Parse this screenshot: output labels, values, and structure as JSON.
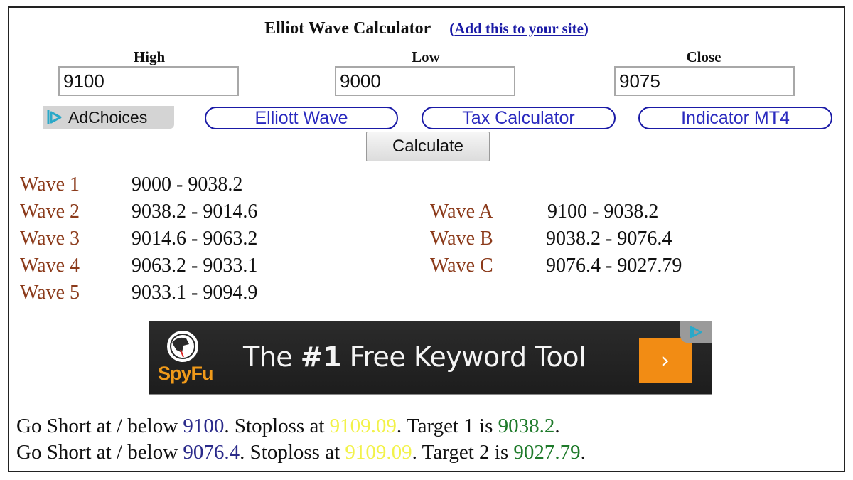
{
  "header": {
    "title": "Elliot Wave Calculator",
    "link_open": "(",
    "link_label": "Add this to your site",
    "link_close": ")"
  },
  "inputs": {
    "high": {
      "label": "High",
      "value": "9100"
    },
    "low": {
      "label": "Low",
      "value": "9000"
    },
    "close": {
      "label": "Close",
      "value": "9075"
    }
  },
  "adchoices": {
    "label": "AdChoices",
    "icon": "adchoices-icon"
  },
  "links": [
    {
      "label": "Elliott Wave"
    },
    {
      "label": "Tax Calculator"
    },
    {
      "label": "Indicator MT4"
    }
  ],
  "calculate_label": "Calculate",
  "impulse_waves": [
    {
      "name": "Wave 1",
      "range": "9000 - 9038.2"
    },
    {
      "name": "Wave 2",
      "range": "9038.2 - 9014.6"
    },
    {
      "name": "Wave 3",
      "range": "9014.6 - 9063.2"
    },
    {
      "name": "Wave 4",
      "range": "9063.2 - 9033.1"
    },
    {
      "name": "Wave 5",
      "range": "9033.1 - 9094.9"
    }
  ],
  "corrective_waves": [
    {
      "name": "Wave A",
      "range": "9100 - 9038.2"
    },
    {
      "name": "Wave B",
      "range": "9038.2 - 9076.4"
    },
    {
      "name": "Wave C",
      "range": "9076.4 - 9027.79"
    }
  ],
  "ad_banner": {
    "brand": "SpyFu",
    "headline_pre": "The ",
    "headline_bold": "#1",
    "headline_post": " Free Keyword Tool",
    "cta": "›"
  },
  "signals": [
    {
      "prefix": "Go Short at / below ",
      "entry": "9100",
      "mid": ". Stoploss at ",
      "stoploss": "9109.09",
      "target_label": ". Target 1 is ",
      "target": "9038.2",
      "suffix": "."
    },
    {
      "prefix": "Go Short at / below ",
      "entry": "9076.4",
      "mid": ". Stoploss at ",
      "stoploss": "9109.09",
      "target_label": ". Target 2 is ",
      "target": "9027.79",
      "suffix": "."
    }
  ],
  "colors": {
    "link_blue": "#1a1aa6",
    "wave_label": "#8b3a1a",
    "entry": "#2a2a8a",
    "stoploss": "#f2f24a",
    "target": "#1e7a2a",
    "ad_orange": "#f28c14"
  }
}
